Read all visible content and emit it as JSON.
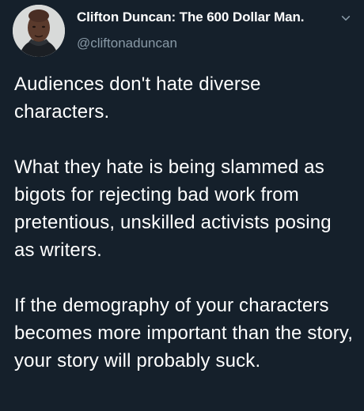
{
  "tweet": {
    "author": {
      "name": "Clifton Duncan: The 600 Dollar Man.",
      "handle": "@cliftonaduncan",
      "avatar_icon": "profile-avatar"
    },
    "menu_icon": "chevron-down-icon",
    "paragraphs": [
      "Audiences don't hate diverse characters.",
      "What they hate is being slammed as bigots for rejecting bad work from pretentious, unskilled activists posing as writers.",
      "If the demography of your characters becomes more important than the story, your story will probably suck."
    ]
  },
  "colors": {
    "background": "#15202b",
    "text": "#ffffff",
    "secondary_text": "#8899a6"
  }
}
